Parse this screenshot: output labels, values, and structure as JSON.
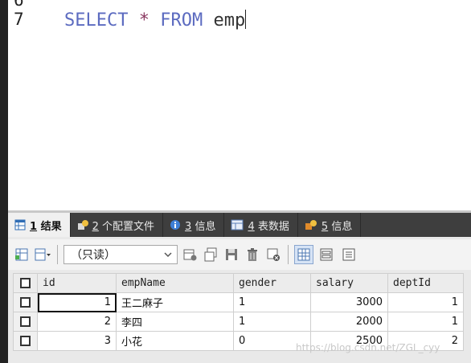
{
  "editor": {
    "line_above": "6",
    "line_no": "7",
    "kw_select": "SELECT",
    "star": "*",
    "kw_from": "FROM",
    "table": "emp"
  },
  "tabs": [
    {
      "num": "1",
      "label": "结果",
      "icon": "grid-icon"
    },
    {
      "num": "2",
      "label": "个配置文件",
      "icon": "profile-icon"
    },
    {
      "num": "3",
      "label": "信息",
      "icon": "info-icon"
    },
    {
      "num": "4",
      "label": "表数据",
      "icon": "table-icon"
    },
    {
      "num": "5",
      "label": "信息",
      "icon": "info-icon"
    }
  ],
  "toolbar": {
    "mode_value": "（只读）"
  },
  "columns": [
    "id",
    "empName",
    "gender",
    "salary",
    "deptId"
  ],
  "rows": [
    [
      "1",
      "王二麻子",
      "1",
      "3000",
      "1"
    ],
    [
      "2",
      "李四",
      "1",
      "2000",
      "1"
    ],
    [
      "3",
      "小花",
      "0",
      "2500",
      "2"
    ]
  ],
  "watermark": "https://blog.csdn.net/ZGL_cyy"
}
